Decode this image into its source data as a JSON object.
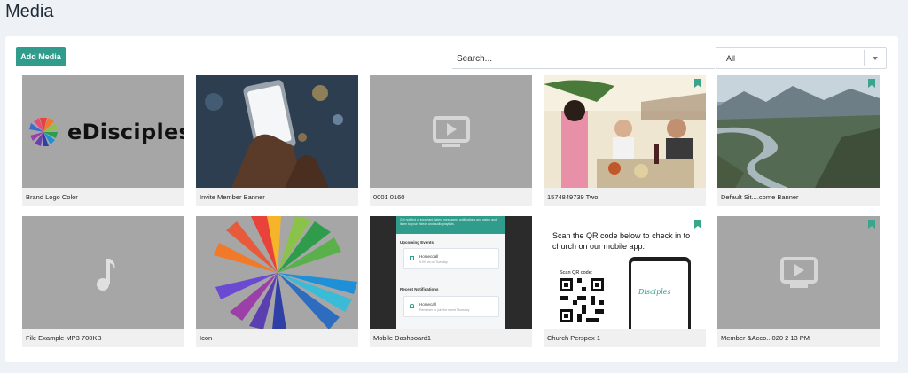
{
  "page": {
    "title": "Media"
  },
  "toolbar": {
    "add_label": "Add Media",
    "search_placeholder": "Search...",
    "filter_value": "All"
  },
  "colors": {
    "accent": "#2f9c8c",
    "bookmark": "#3aa58a",
    "thumb_placeholder": "#a6a6a6"
  },
  "media": [
    {
      "label": "Brand Logo Color",
      "thumb": "logo",
      "bookmarked": false,
      "logo_text": "eDisciples"
    },
    {
      "label": "Invite Member Banner",
      "thumb": "phone-photo",
      "bookmarked": false
    },
    {
      "label": "0001 0160",
      "thumb": "video-icon",
      "bookmarked": false
    },
    {
      "label": "1574849739 Two",
      "thumb": "dinner-photo",
      "bookmarked": true
    },
    {
      "label": "Default Sit....come Banner",
      "thumb": "landscape-photo",
      "bookmarked": true
    },
    {
      "label": "File Example MP3 700KB",
      "thumb": "audio-icon",
      "bookmarked": false
    },
    {
      "label": "Icon",
      "thumb": "burst",
      "bookmarked": false
    },
    {
      "label": "Mobile Dashboard1",
      "thumb": "app-screenshot",
      "bookmarked": false,
      "app": {
        "intro": "Get notified of important dates, messages, notifications and watch and listen to your videos and audio playlists.",
        "upcoming_heading": "Upcoming Events",
        "event_title": "Homecoall",
        "event_sub": "9:00 am on Tuesday",
        "notifications_heading": "Recent Notifications",
        "notification_title": "Homecall",
        "notification_sub": "Reminder to join the event Thursday"
      }
    },
    {
      "label": "Church Perspex 1",
      "thumb": "qr-poster",
      "bookmarked": true,
      "poster": {
        "headline": "Scan the QR code below to check in to church on our mobile app.",
        "qr_label": "Scan QR code:",
        "phone_sig": "Disciples"
      }
    },
    {
      "label": "Member &Acco...020 2 13 PM",
      "thumb": "video-icon",
      "bookmarked": true
    }
  ]
}
